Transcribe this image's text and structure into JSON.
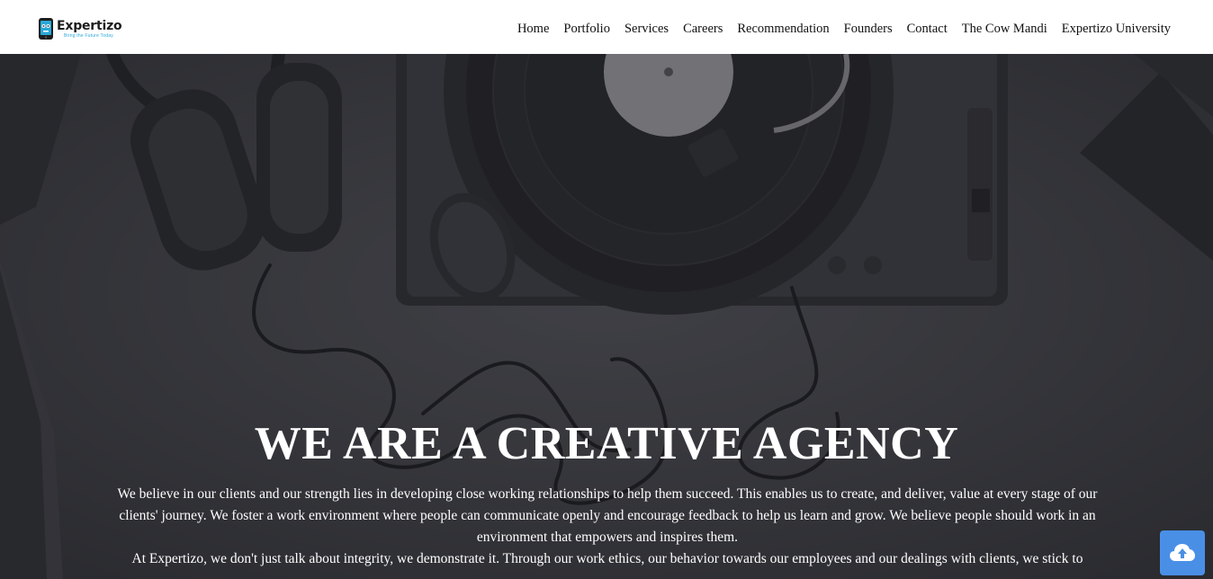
{
  "brand": {
    "name": "Expertizo",
    "tagline": "Bring the Future Today",
    "accent_color": "#2aa8d8",
    "logo_icon": "phone-robot-icon"
  },
  "nav": {
    "items": [
      {
        "label": "Home"
      },
      {
        "label": "Portfolio"
      },
      {
        "label": "Services"
      },
      {
        "label": "Careers"
      },
      {
        "label": "Recommendation"
      },
      {
        "label": "Founders"
      },
      {
        "label": "Contact"
      },
      {
        "label": "The Cow Mandi"
      },
      {
        "label": "Expertizo University"
      }
    ]
  },
  "hero": {
    "title": "WE ARE A CREATIVE AGENCY",
    "paragraph_1": "We believe in our clients and our strength lies in developing close working relationships to help them succeed. This enables us to create, and deliver, value at every stage of our clients' journey. We foster a work environment where people can communicate openly and encourage feedback to help us learn and grow. We believe people should work in an environment that empowers and inspires them.",
    "paragraph_2": "At Expertizo, we don't just talk about integrity, we demonstrate it. Through our work ethics, our behavior towards our employees and our dealings with clients, we stick to",
    "background_image": "turntable-headphones-photo"
  },
  "scroll_top": {
    "icon": "cloud-upload-icon",
    "color": "#4a8fe6"
  }
}
